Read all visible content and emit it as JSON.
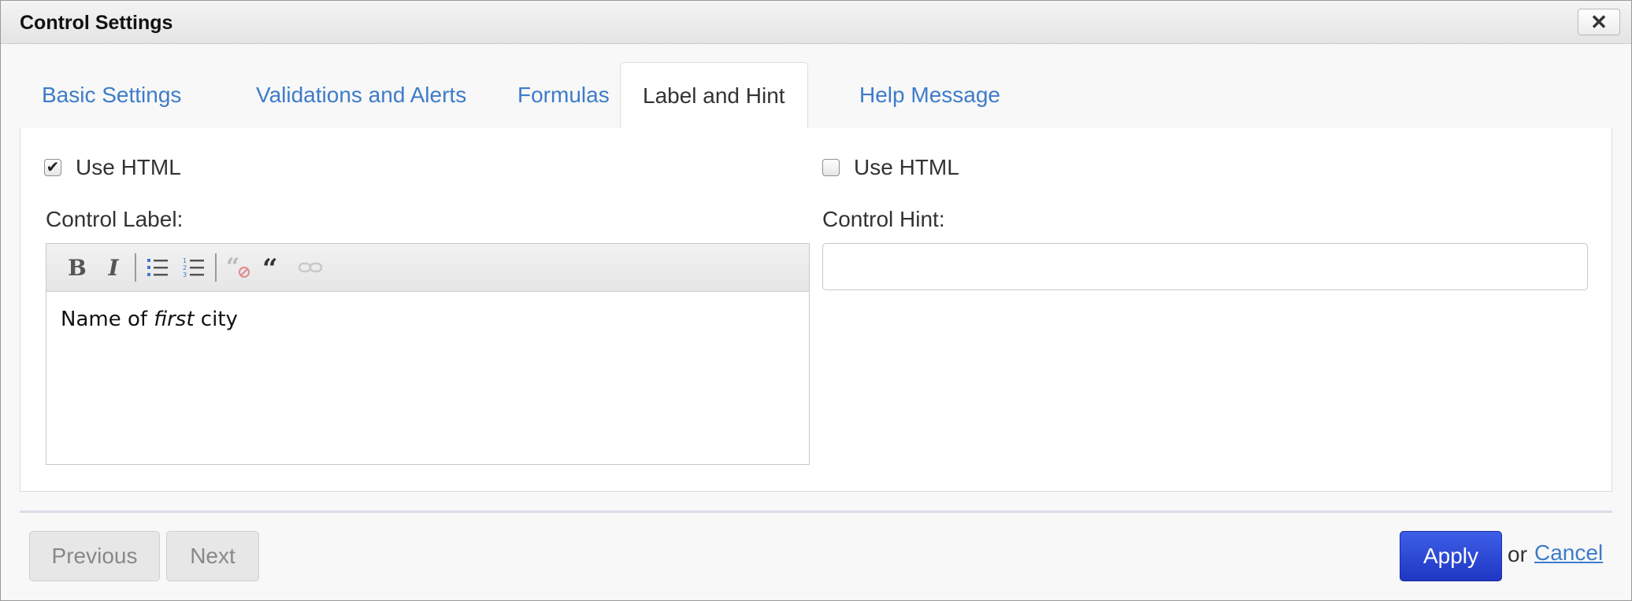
{
  "dialog": {
    "title": "Control Settings",
    "close_icon": "close-icon"
  },
  "tabs": [
    {
      "label": "Basic Settings",
      "active": false
    },
    {
      "label": "Validations and Alerts",
      "active": false
    },
    {
      "label": "Formulas",
      "active": false
    },
    {
      "label": "Label and Hint",
      "active": true
    },
    {
      "label": "Help Message",
      "active": false
    }
  ],
  "label_section": {
    "use_html_label": "Use HTML",
    "use_html_checked": true,
    "field_label": "Control Label:",
    "toolbar": [
      "bold-icon",
      "italic-icon",
      "bulleted-list-icon",
      "numbered-list-icon",
      "unquote-icon",
      "blockquote-icon",
      "link-icon"
    ],
    "content_prefix": "Name of ",
    "content_italic": "first",
    "content_suffix": " city"
  },
  "hint_section": {
    "use_html_label": "Use HTML",
    "use_html_checked": false,
    "field_label": "Control Hint:",
    "value": ""
  },
  "footer": {
    "previous_label": "Previous",
    "next_label": "Next",
    "apply_label": "Apply",
    "or_text": "or",
    "cancel_label": "Cancel"
  },
  "colors": {
    "link": "#3d7cc9",
    "apply": "#2a46d8"
  }
}
